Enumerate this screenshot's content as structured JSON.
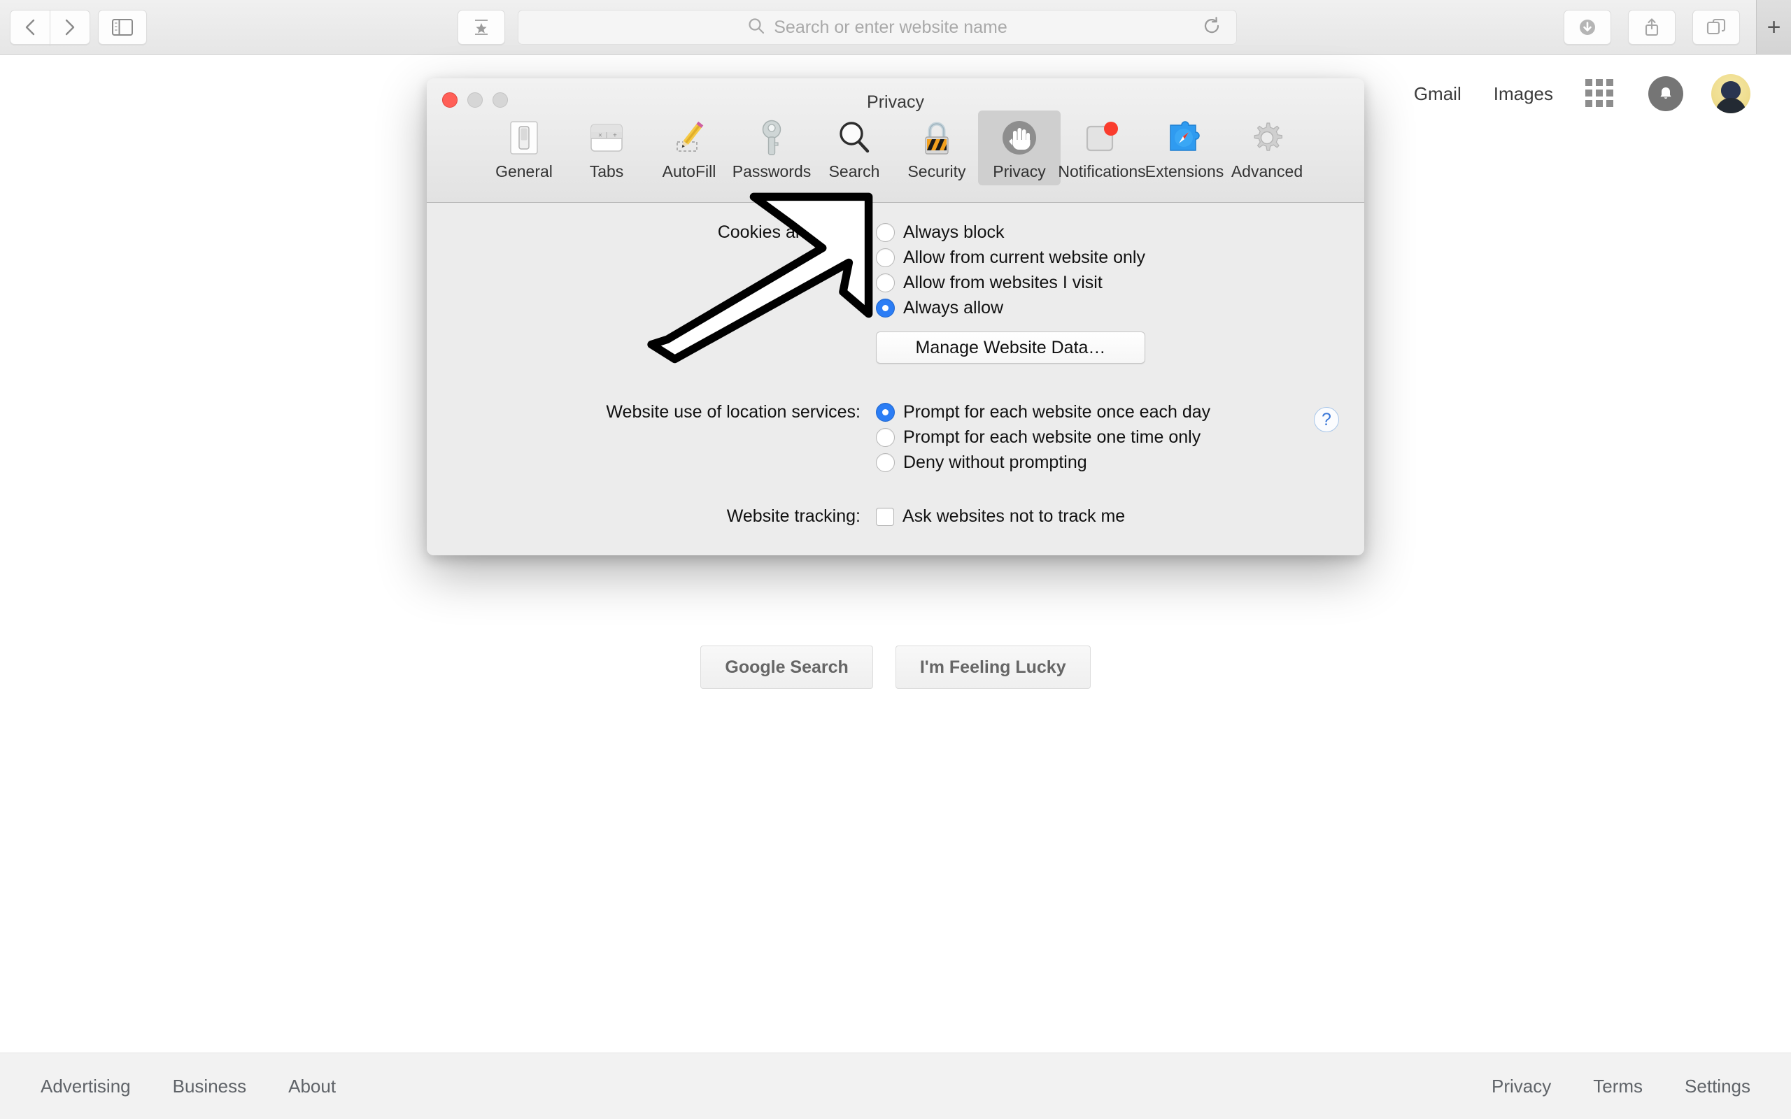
{
  "browser": {
    "back_icon": "chevron-left-icon",
    "forward_icon": "chevron-right-icon",
    "sidebar_icon": "sidebar-toggle-icon",
    "bookmark_icon": "bookmark-star-icon",
    "search_icon": "search-icon",
    "reload_icon": "reload-icon",
    "download_icon": "download-icon",
    "share_icon": "share-icon",
    "tab_overview_icon": "tab-overview-icon",
    "new_tab_label": "+",
    "address_placeholder": "Search or enter website name",
    "address_value": ""
  },
  "google": {
    "nav_links": [
      "Gmail",
      "Images"
    ],
    "apps_icon": "apps-grid-icon",
    "bell_icon": "bell-icon",
    "avatar_icon": "user-avatar",
    "buttons": [
      "Google Search",
      "I'm Feeling Lucky"
    ],
    "footer_left": [
      "Advertising",
      "Business",
      "About"
    ],
    "footer_right": [
      "Privacy",
      "Terms",
      "Settings"
    ]
  },
  "prefs": {
    "title": "Privacy",
    "traffic_lights": [
      "close",
      "minimize",
      "maximize"
    ],
    "toolbar": [
      {
        "label": "General",
        "icon": "general-switch-icon",
        "selected": false
      },
      {
        "label": "Tabs",
        "icon": "tabs-icon",
        "selected": false
      },
      {
        "label": "AutoFill",
        "icon": "autofill-pencil-icon",
        "selected": false
      },
      {
        "label": "Passwords",
        "icon": "key-icon",
        "selected": false
      },
      {
        "label": "Search",
        "icon": "magnifier-icon",
        "selected": false
      },
      {
        "label": "Security",
        "icon": "padlock-icon",
        "selected": false
      },
      {
        "label": "Privacy",
        "icon": "hand-stop-icon",
        "selected": true
      },
      {
        "label": "Notifications",
        "icon": "notification-badge-icon",
        "selected": false
      },
      {
        "label": "Extensions",
        "icon": "puzzle-compass-icon",
        "selected": false
      },
      {
        "label": "Advanced",
        "icon": "gear-icon",
        "selected": false
      }
    ],
    "sections": [
      {
        "label": "Cookies and webs",
        "label_full": "Cookies and website data:",
        "options": [
          {
            "text": "Always block",
            "checked": false
          },
          {
            "text": "Allow from current website only",
            "checked": false
          },
          {
            "text": "Allow from websites I visit",
            "checked": false
          },
          {
            "text": "Always allow",
            "checked": true
          }
        ],
        "button": "Manage Website Data…"
      },
      {
        "label": "Website use of location services:",
        "options": [
          {
            "text": "Prompt for each website once each day",
            "checked": true
          },
          {
            "text": "Prompt for each website one time only",
            "checked": false
          },
          {
            "text": "Deny without prompting",
            "checked": false
          }
        ]
      },
      {
        "label": "Website tracking:",
        "checkbox": {
          "text": "Ask websites not to track me",
          "checked": false
        }
      }
    ],
    "help_label": "?",
    "accent_color": "#2b7df5"
  },
  "annotation": {
    "arrow_icon": "pointing-arrow-annotation",
    "direction": "up-right",
    "target": "Privacy toolbar tab"
  }
}
